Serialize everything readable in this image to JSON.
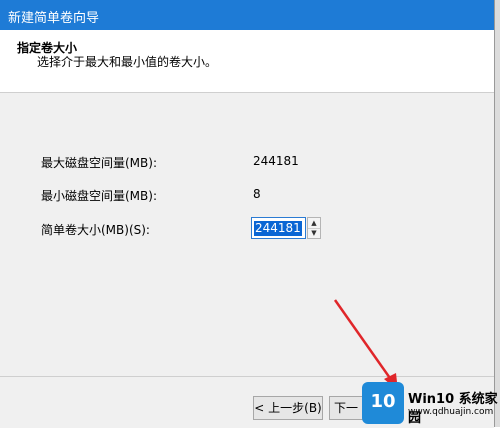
{
  "window": {
    "title": "新建简单卷向导"
  },
  "header": {
    "heading": "指定卷大小",
    "subheading": "选择介于最大和最小值的卷大小。"
  },
  "fields": {
    "max_label": "最大磁盘空间量(MB):",
    "max_value": "244181",
    "min_label": "最小磁盘空间量(MB):",
    "min_value": "8",
    "size_label": "简单卷大小(MB)(S):",
    "size_value": "244181"
  },
  "footer": {
    "back_label": "< 上一步(B)",
    "next_label": "下一"
  },
  "watermark": {
    "logo_text": "10",
    "title": "Win10 系统家园",
    "url": "www.qdhuajin.com"
  },
  "icons": {
    "arrow": "red-arrow-annotation",
    "spin_up": "spin-up-icon",
    "spin_down": "spin-down-icon"
  },
  "colors": {
    "titlebar": "#1e7bd6",
    "selection": "#0a66d4",
    "arrow": "#e0262a",
    "watermark_logo": "#1f8ad8"
  }
}
